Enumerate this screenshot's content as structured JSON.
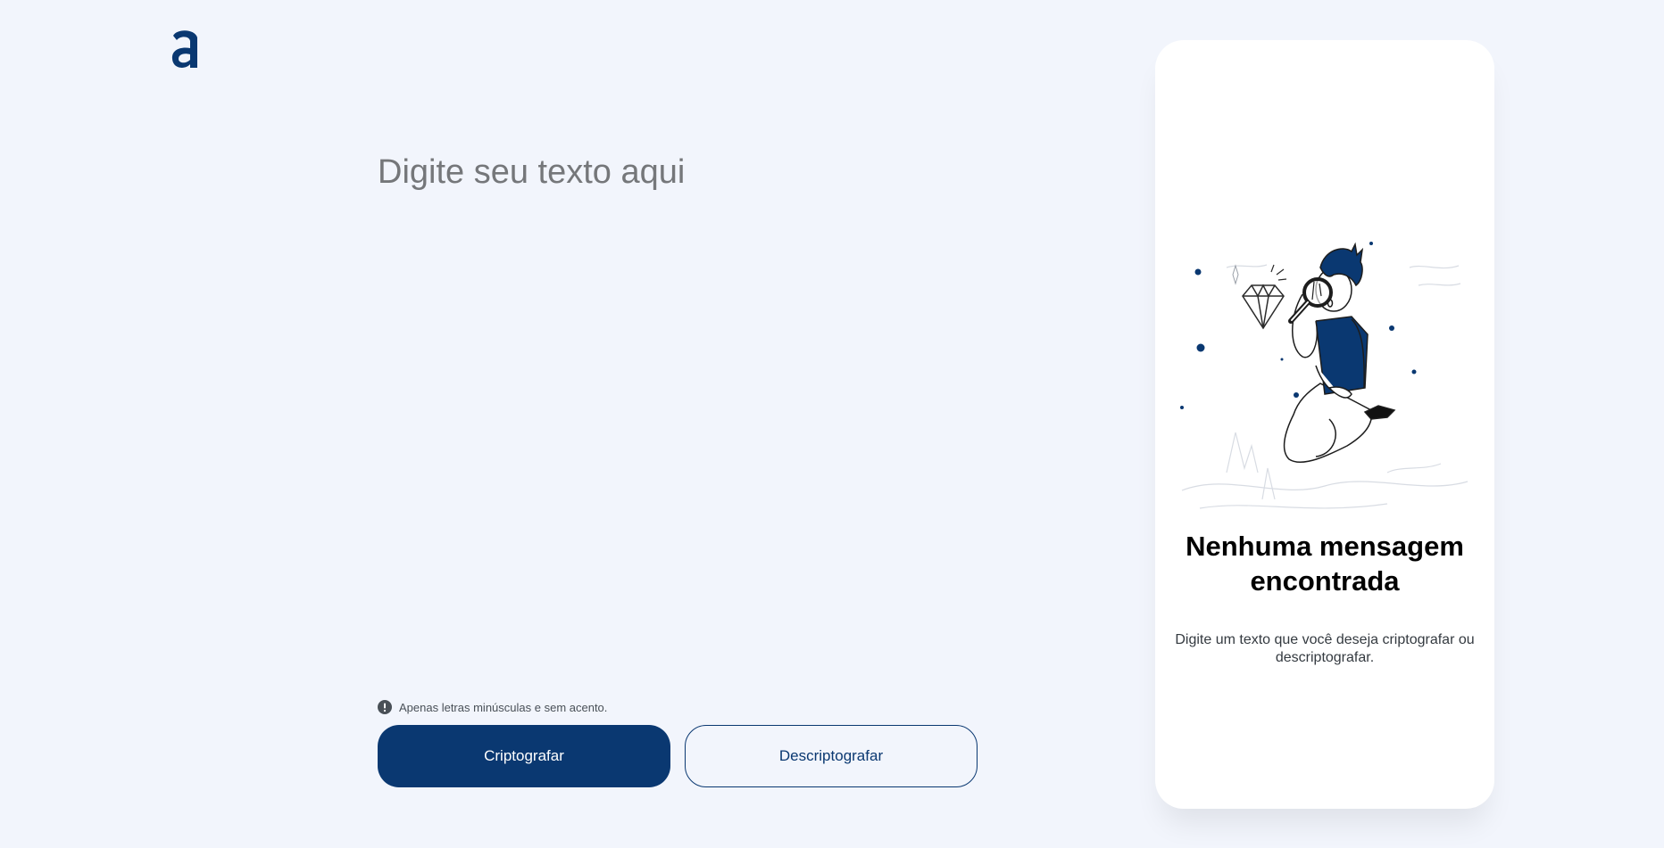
{
  "logo": {
    "icon": "alura-a-logo-icon",
    "color": "#0a3871"
  },
  "input": {
    "placeholder": "Digite seu texto aqui",
    "value": ""
  },
  "notice": {
    "icon": "exclamation-circle-icon",
    "text": "Apenas letras minúsculas e sem acento."
  },
  "buttons": {
    "encrypt_label": "Criptografar",
    "decrypt_label": "Descriptografar"
  },
  "output_panel": {
    "illustration": "person-with-magnifying-glass-illustration",
    "title": "Nenhuma mensagem encontrada",
    "description": "Digite um texto que você deseja criptografar ou descriptografar."
  },
  "colors": {
    "accent": "#0a3871",
    "background": "#f2f5fc",
    "panel": "#ffffff"
  }
}
